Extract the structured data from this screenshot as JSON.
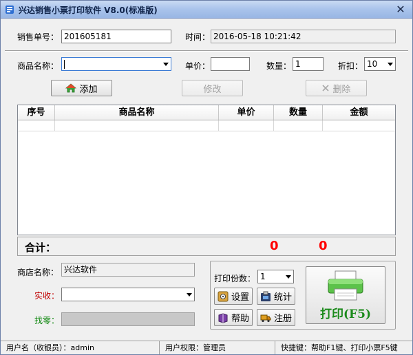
{
  "window": {
    "title": "兴达销售小票打印软件 V8.0(标准版)",
    "close_glyph": "✕"
  },
  "order": {
    "number_label": "销售单号：",
    "number_value": "201605181",
    "time_label": "时间：",
    "time_value": "2016-05-18 10:21:42"
  },
  "item_entry": {
    "name_label": "商品名称：",
    "name_value": "",
    "price_label": "单价：",
    "price_value": "",
    "qty_label": "数量：",
    "qty_value": "1",
    "discount_label": "折扣：",
    "discount_value": "10"
  },
  "actions": {
    "add": "添加",
    "modify": "修改",
    "delete": "删除"
  },
  "table": {
    "columns": [
      "序号",
      "商品名称",
      "单价",
      "数量",
      "金额"
    ]
  },
  "totals": {
    "label": "合计：",
    "quantity": "0",
    "amount": "0"
  },
  "shop": {
    "name_label": "商店名称：",
    "name_value": "兴达软件",
    "received_label": "实收：",
    "received_value": "",
    "change_label": "找零：",
    "change_value": ""
  },
  "print": {
    "copies_label": "打印份数：",
    "copies_value": "1",
    "settings": "设置",
    "stats": "统计",
    "help": "帮助",
    "register": "注册",
    "print_button": "打印(F5)"
  },
  "status": {
    "user": "用户名（收银员）：admin",
    "permission": "用户权限：管理员",
    "shortcuts": "快捷键：帮助F1键、打印小票F5键"
  },
  "colors": {
    "total_value": "#ff0000",
    "received_label": "#c00000",
    "change_label": "#008000",
    "print_text": "#1a8a1a"
  }
}
